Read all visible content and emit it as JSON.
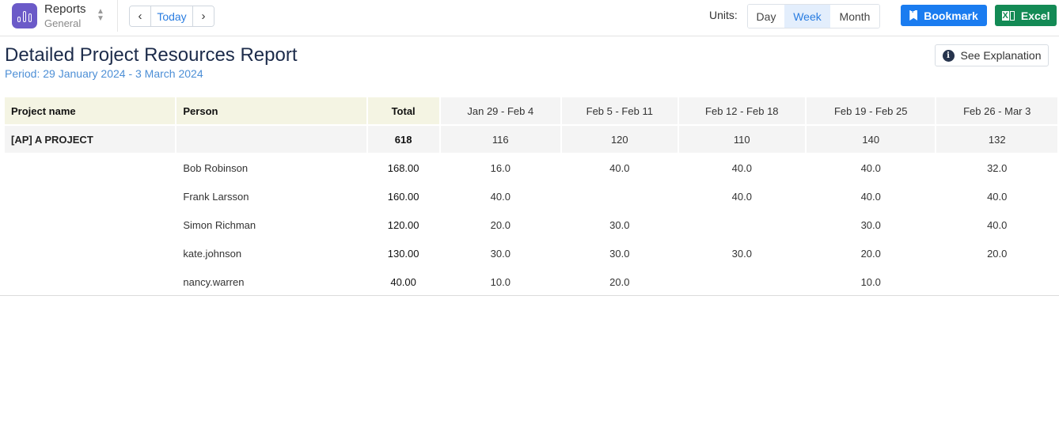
{
  "app": {
    "title": "Reports",
    "subtitle": "General",
    "icon": "bar-chart-icon",
    "accent": "#6b5ac8"
  },
  "nav": {
    "prev_icon": "‹",
    "today_label": "Today",
    "next_icon": "›"
  },
  "units": {
    "label": "Units:",
    "options": [
      "Day",
      "Week",
      "Month"
    ],
    "selected": "Week"
  },
  "actions": {
    "bookmark_label": "Bookmark",
    "bookmark_color": "#1a7cf0",
    "excel_label": "Excel",
    "excel_color": "#138a55"
  },
  "header": {
    "title": "Detailed Project Resources Report",
    "period": "Period: 29 January 2024 - 3 March 2024",
    "explain_label": "See Explanation"
  },
  "table": {
    "columns": {
      "project": "Project name",
      "person": "Person",
      "total": "Total",
      "weeks": [
        "Jan 29 - Feb 4",
        "Feb 5 - Feb 11",
        "Feb 12 - Feb 18",
        "Feb 19 - Feb 25",
        "Feb 26 - Mar 3"
      ]
    },
    "project": {
      "name": "[AP] A PROJECT",
      "total": "618",
      "weeks": [
        "116",
        "120",
        "110",
        "140",
        "132"
      ]
    },
    "people": [
      {
        "name": "Bob Robinson",
        "total": "168.00",
        "weeks": [
          "16.0",
          "40.0",
          "40.0",
          "40.0",
          "32.0"
        ]
      },
      {
        "name": "Frank Larsson",
        "total": "160.00",
        "weeks": [
          "40.0",
          "",
          "40.0",
          "40.0",
          "40.0"
        ]
      },
      {
        "name": "Simon Richman",
        "total": "120.00",
        "weeks": [
          "20.0",
          "30.0",
          "",
          "30.0",
          "40.0"
        ]
      },
      {
        "name": "kate.johnson",
        "total": "130.00",
        "weeks": [
          "30.0",
          "30.0",
          "30.0",
          "20.0",
          "20.0"
        ]
      },
      {
        "name": "nancy.warren",
        "total": "40.00",
        "weeks": [
          "10.0",
          "20.0",
          "",
          "10.0",
          ""
        ]
      }
    ]
  }
}
